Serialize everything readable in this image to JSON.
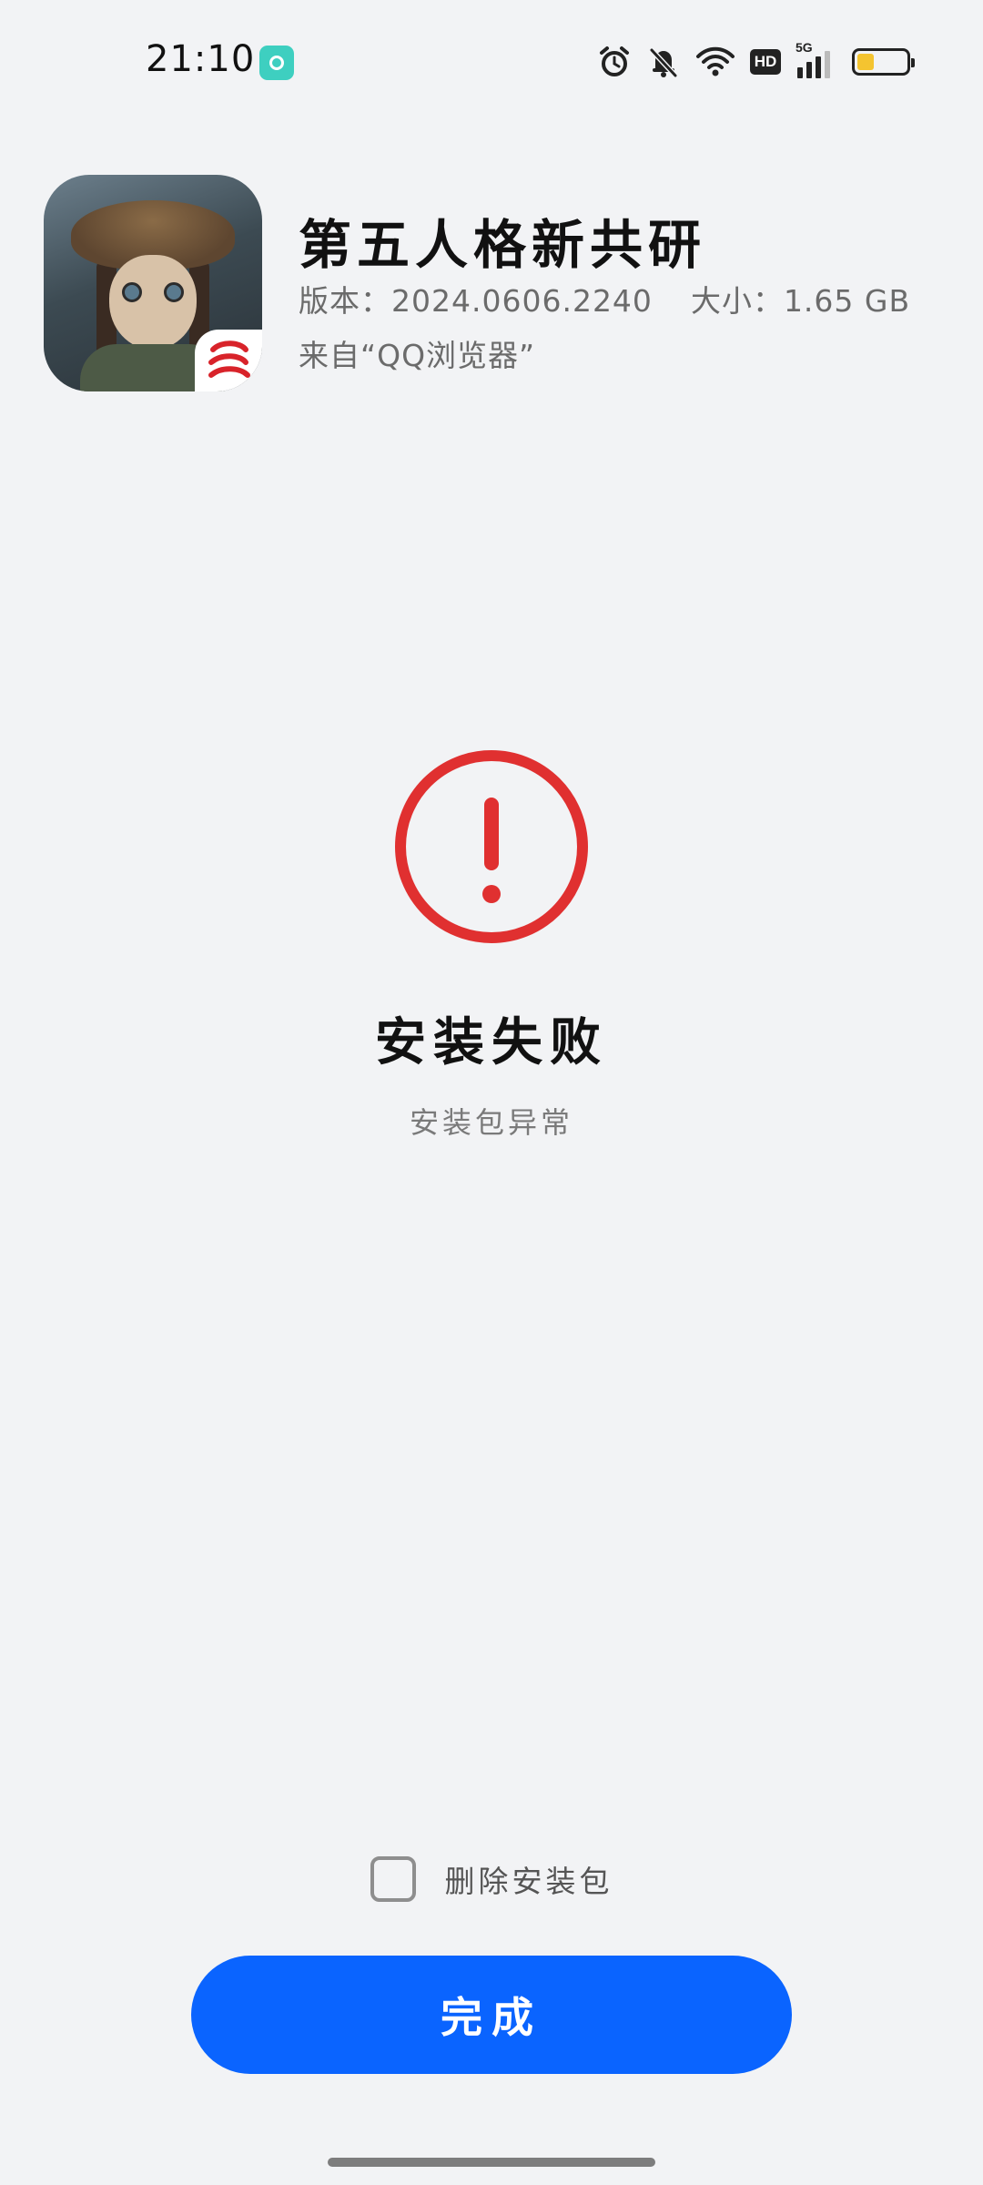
{
  "status_bar": {
    "time": "21:10",
    "network": "5G",
    "hd_label": "HD",
    "battery_level": 0.35,
    "battery_color": "#f4c430",
    "app_notification_icon": "music-disc-icon",
    "app_notification_color": "#3ecfc0"
  },
  "app": {
    "name": "第五人格新共研",
    "version_label": "版本：",
    "version": "2024.0606.2240",
    "size_label": "大小：",
    "size": "1.65 GB",
    "source": "来自“QQ浏览器”",
    "icon": "identity-v-app-icon"
  },
  "result": {
    "icon": "error-exclamation-icon",
    "icon_color": "#e03030",
    "title": "安装失败",
    "subtitle": "安装包异常"
  },
  "controls": {
    "delete_package_label": "删除安装包",
    "delete_package_checked": false,
    "done_label": "完成",
    "accent_color": "#0a64ff"
  }
}
